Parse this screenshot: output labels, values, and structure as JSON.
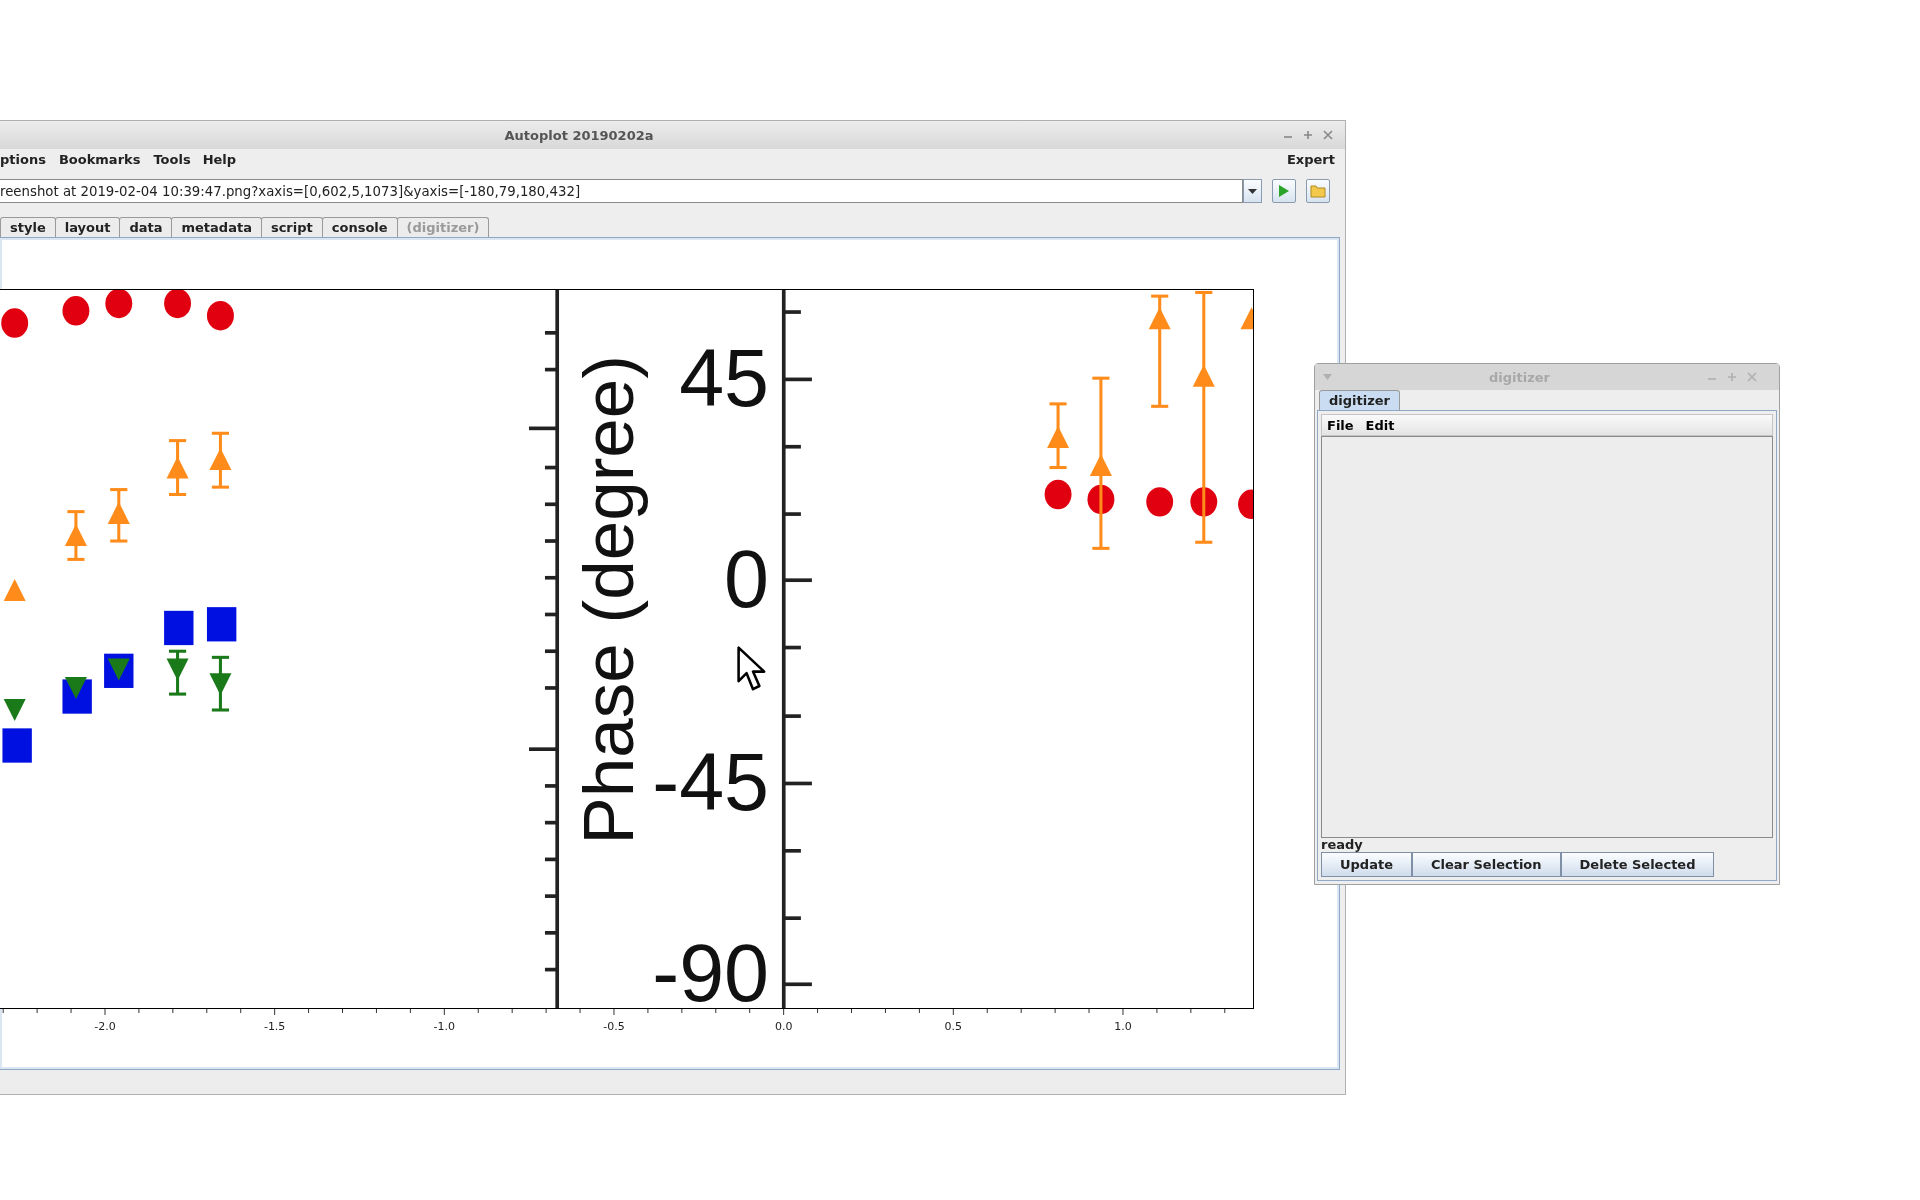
{
  "main_window": {
    "title": "Autoplot 20190202a",
    "menu": [
      {
        "label": "ptions"
      },
      {
        "label": "Bookmarks"
      },
      {
        "label": "Tools"
      },
      {
        "label": "Help"
      }
    ],
    "expert": "Expert",
    "address": {
      "value": "reenshot at 2019-02-04 10:39:47.png?xaxis=[0,602,5,1073]&yaxis=[-180,79,180,432]"
    },
    "tabs": [
      {
        "label": "style",
        "selected": false,
        "disabled": false
      },
      {
        "label": "layout",
        "selected": false,
        "disabled": false
      },
      {
        "label": "data",
        "selected": false,
        "disabled": false
      },
      {
        "label": "metadata",
        "selected": false,
        "disabled": false
      },
      {
        "label": "script",
        "selected": false,
        "disabled": false
      },
      {
        "label": "console",
        "selected": false,
        "disabled": false
      },
      {
        "label": "(digitizer)",
        "selected": false,
        "disabled": true
      }
    ],
    "plot": {
      "figure": {
        "ylabel": "Phase (degree)",
        "yticks": [
          "45",
          "0",
          "-45",
          "-90"
        ]
      },
      "x_ticks": [
        "-2.0",
        "-1.5",
        "-1.0",
        "-0.5",
        "0.0",
        "0.5",
        "1.0"
      ]
    }
  },
  "digitizer": {
    "title": "digitizer",
    "tabs": [
      {
        "label": "digitizer",
        "selected": true
      }
    ],
    "menu": [
      "File",
      "Edit"
    ],
    "status": "ready",
    "buttons": [
      "Update",
      "Clear Selection",
      "Delete Selected"
    ]
  }
}
